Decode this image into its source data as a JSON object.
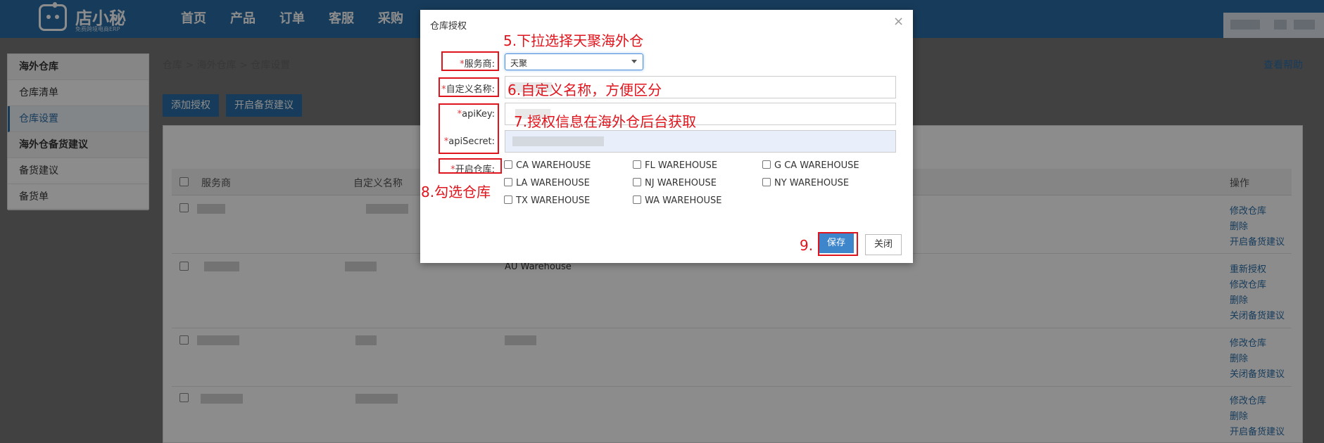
{
  "app": {
    "logo_name": "店小秘",
    "logo_sub": "免费跨境电商ERP"
  },
  "nav": [
    "首页",
    "产品",
    "订单",
    "客服",
    "采购"
  ],
  "sidebar": {
    "items": [
      {
        "label": "海外仓库"
      },
      {
        "label": "仓库清单"
      },
      {
        "label": "仓库设置"
      },
      {
        "label": "海外仓备货建议"
      },
      {
        "label": "备货建议"
      },
      {
        "label": "备货单"
      }
    ]
  },
  "breadcrumb": "仓库 > 海外仓库 > 仓库设置",
  "help_link": "查看帮助",
  "toolbar": {
    "add_auth": "添加授权",
    "enable_suggest": "开启备货建议"
  },
  "table": {
    "headers": {
      "provider": "服务商",
      "custom_name": "自定义名称",
      "action": "操作"
    },
    "row2_warehouse": "AU Warehouse",
    "actions": [
      [
        "修改仓库",
        "删除",
        "开启备货建议"
      ],
      [
        "重新授权",
        "修改仓库",
        "删除",
        "关闭备货建议"
      ],
      [
        "修改仓库",
        "删除",
        "关闭备货建议"
      ],
      [
        "修改仓库",
        "删除",
        "开启备货建议"
      ]
    ]
  },
  "modal": {
    "title": "仓库授权",
    "close_icon": "×",
    "labels": {
      "provider": "服务商:",
      "custom_name": "自定义名称:",
      "api_key": "apiKey:",
      "api_secret": "apiSecret:",
      "enable_warehouse": "开启仓库:"
    },
    "required_mark": "*",
    "provider_value": "天聚",
    "warehouses": [
      "CA WAREHOUSE",
      "FL WAREHOUSE",
      "G CA WAREHOUSE",
      "LA WAREHOUSE",
      "NJ WAREHOUSE",
      "NY WAREHOUSE",
      "TX WAREHOUSE",
      "WA WAREHOUSE"
    ],
    "save": "保存",
    "close": "关闭"
  },
  "annotations": {
    "step5": "5.下拉选择天聚海外仓",
    "step6": "6.自定义名称，方便区分",
    "step7": "7.授权信息在海外仓后台获取",
    "step8": "8.勾选仓库",
    "step9": "9."
  },
  "colors": {
    "brand": "#2b6ea7",
    "annotation": "#e0141c",
    "primary_button": "#3d86cc"
  }
}
